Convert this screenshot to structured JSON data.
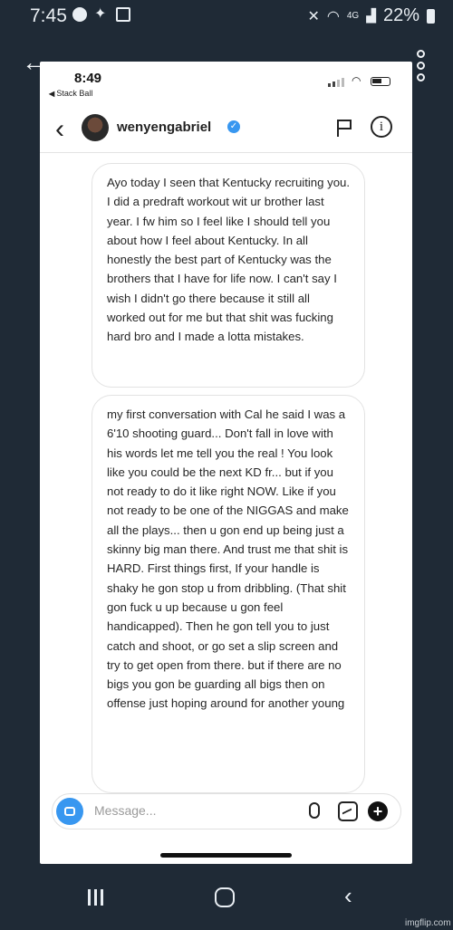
{
  "device_status": {
    "time": "7:45",
    "battery": "22%",
    "network": "4G"
  },
  "icons": {
    "back": "arrow-left-icon",
    "overflow": "more-vertical-icon"
  },
  "screenshot": {
    "status": {
      "time": "8:49",
      "back_app": "Stack Ball"
    },
    "header": {
      "username": "wenyengabriel",
      "verified": true,
      "back_glyph": "‹",
      "info_glyph": "i"
    },
    "messages": [
      {
        "text": "Ayo today I seen that Kentucky recruiting you. I did a predraft workout wit ur brother last year. I fw him so I feel like I should tell you about how I feel about Kentucky. In all honestly the best part of Kentucky was the brothers that I have for life now. I can't say I wish I didn't go there because it still all worked out for me but that shit was fucking hard bro and I made a lotta mistakes."
      },
      {
        "text": "my first conversation with Cal he said I was a 6'10 shooting guard... Don't fall in love with his words let me tell you the real ! You look like you could be the next KD fr... but if you not ready to do it like right NOW. Like if you not ready to be one of the NIGGAS and make all the plays... then u gon end up being just a skinny big man there. And trust me that shit is HARD. First things first, If your handle is shaky he gon stop u from dribbling. (That shit gon fuck u up because u gon feel handicapped). Then he gon tell you to just catch and shoot, or go set a slip screen and try to get open from there. but if there are no bigs you gon be guarding all bigs then on offense just hoping around for another young"
      }
    ],
    "composer": {
      "placeholder": "Message..."
    }
  },
  "watermark": "imgflip.com"
}
